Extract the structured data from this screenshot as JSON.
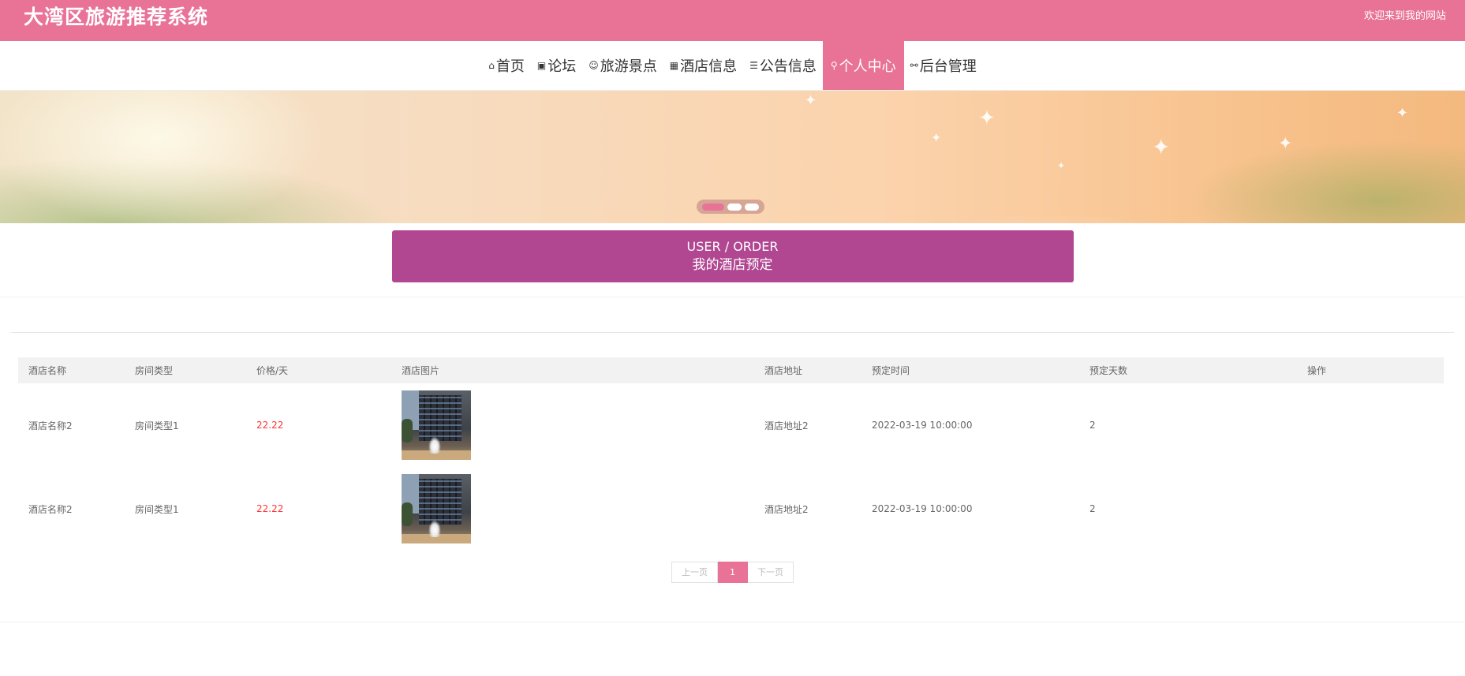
{
  "header": {
    "site_title": "大湾区旅游推荐系统",
    "welcome_text": "欢迎来到我的网站"
  },
  "nav": {
    "items": [
      {
        "label": "首页",
        "icon": "home-icon",
        "active": false
      },
      {
        "label": "论坛",
        "icon": "forum-icon",
        "active": false
      },
      {
        "label": "旅游景点",
        "icon": "attraction-icon",
        "active": false
      },
      {
        "label": "酒店信息",
        "icon": "grid-icon",
        "active": false
      },
      {
        "label": "公告信息",
        "icon": "sliders-icon",
        "active": false
      },
      {
        "label": "个人中心",
        "icon": "user-icon",
        "active": true
      },
      {
        "label": "后台管理",
        "icon": "link-icon",
        "active": false
      }
    ],
    "glyphs": [
      "⌂",
      "▣",
      "☺",
      "▦",
      "☰",
      "⚲",
      "⚯"
    ]
  },
  "banner": {
    "slide_count": 3,
    "active_slide": 0
  },
  "section": {
    "title_en": "USER / ORDER",
    "title_cn": "我的酒店预定"
  },
  "table": {
    "headers": [
      "酒店名称",
      "房间类型",
      "价格/天",
      "酒店图片",
      "酒店地址",
      "预定时间",
      "预定天数",
      "操作"
    ],
    "rows": [
      {
        "hotel_name": "酒店名称2",
        "room_type": "房间类型1",
        "price": "22.22",
        "address": "酒店地址2",
        "booking_time": "2022-03-19 10:00:00",
        "days": "2",
        "action": ""
      },
      {
        "hotel_name": "酒店名称2",
        "room_type": "房间类型1",
        "price": "22.22",
        "address": "酒店地址2",
        "booking_time": "2022-03-19 10:00:00",
        "days": "2",
        "action": ""
      }
    ]
  },
  "pagination": {
    "prev_label": "上一页",
    "current_page": "1",
    "next_label": "下一页"
  },
  "colors": {
    "brand_pink": "#e87397",
    "section_purple": "#b14691",
    "price_red": "#ff3333"
  }
}
